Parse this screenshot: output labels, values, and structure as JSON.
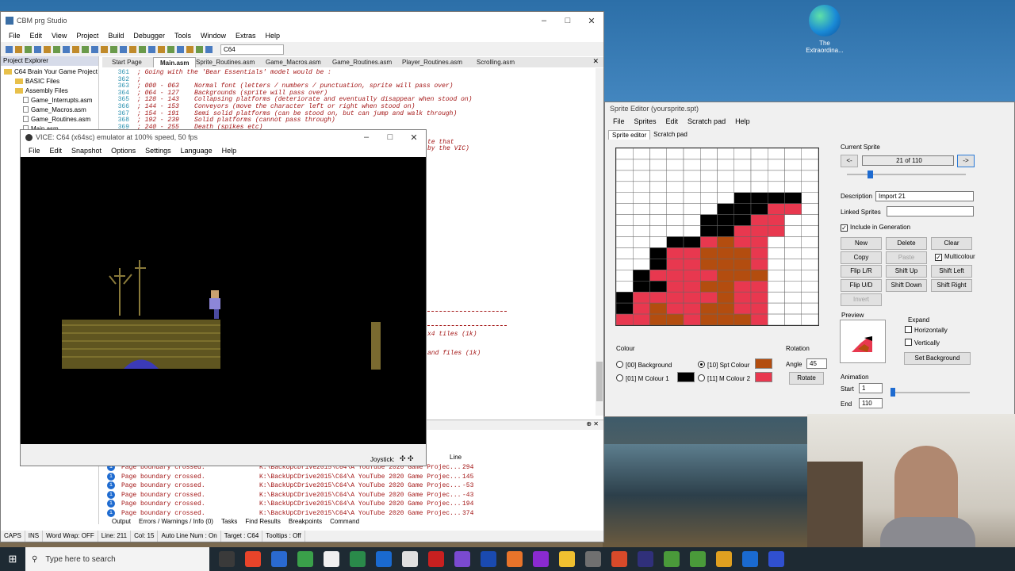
{
  "desktop": {
    "edge_label": "The Extraordina..."
  },
  "ide": {
    "title": "CBM prg Studio",
    "menu": [
      "File",
      "Edit",
      "View",
      "Project",
      "Build",
      "Debugger",
      "Tools",
      "Window",
      "Extras",
      "Help"
    ],
    "toolbar_target": "C64",
    "project_explorer": {
      "title": "Project Explorer",
      "root": "C64 Brain Your Game Project",
      "items": [
        "BASIC Files",
        "Assembly Files",
        "Game_Interrupts.asm",
        "Game_Macros.asm",
        "Game_Routines.asm",
        "Main.asm"
      ]
    },
    "tabs": [
      "Start Page",
      "Main.asm",
      "Sprite_Routines.asm",
      "Game_Macros.asm",
      "Game_Routines.asm",
      "Player_Routines.asm",
      "Scrolling.asm"
    ],
    "line_numbers": [
      "361",
      "362",
      "363",
      "364",
      "365",
      "366",
      "367",
      "368",
      "369"
    ],
    "code_lines": [
      "; Going with the 'Bear Essentials' model would be :",
      ";",
      "; 000 - 063    Normal font (letters / numbers / punctuation, sprite will pass over)",
      "; 064 - 127    Backgrounds (sprite will pass over)",
      "; 128 - 143    Collapsing platforms (deteriorate and eventually disappear when stood on)",
      "; 144 - 153    Conveyors (move the character left or right when stood on)",
      "; 154 - 191    Semi solid platforms (can be stood on, but can jump and walk through)",
      "; 192 - 239    Solid platforms (cannot pass through)",
      "; 240 - 255    Death (spikes etc)"
    ],
    "code_fragments": [
      "te that",
      "by the VIC)",
      "x4 tiles (1k)",
      "and files (1k)"
    ],
    "output": {
      "line_header": "Line",
      "rows": [
        {
          "msg": "Page boundary crossed.",
          "file": "K:\\BackUpCDrive2015\\C64\\A YouTube 2020 Game Projec...",
          "line": "294"
        },
        {
          "msg": "Page boundary crossed.",
          "file": "K:\\BackUpCDrive2015\\C64\\A YouTube 2020 Game Projec...",
          "line": "145"
        },
        {
          "msg": "Page boundary crossed.",
          "file": "K:\\BackUpCDrive2015\\C64\\A YouTube 2020 Game Projec...",
          "line": "-53"
        },
        {
          "msg": "Page boundary crossed.",
          "file": "K:\\BackUpCDrive2015\\C64\\A YouTube 2020 Game Projec...",
          "line": "-43"
        },
        {
          "msg": "Page boundary crossed.",
          "file": "K:\\BackUpCDrive2015\\C64\\A YouTube 2020 Game Projec...",
          "line": "194"
        },
        {
          "msg": "Page boundary crossed.",
          "file": "K:\\BackUpCDrive2015\\C64\\A YouTube 2020 Game Projec...",
          "line": "374"
        }
      ]
    },
    "bottom_tabs": [
      "Output",
      "Errors / Warnings / Info (0)",
      "Tasks",
      "Find Results",
      "Breakpoints",
      "Command"
    ],
    "status": [
      "CAPS",
      "INS",
      "Word Wrap: OFF",
      "Line: 211",
      "Col: 15",
      "Auto Line Num : On",
      "Target : C64",
      "Tooltips : Off"
    ]
  },
  "vice": {
    "title": "VICE: C64 (x64sc) emulator at 100% speed, 50 fps",
    "menu": [
      "File",
      "Edit",
      "Snapshot",
      "Options",
      "Settings",
      "Language",
      "Help"
    ],
    "joystick": "Joystick:"
  },
  "sprite_editor": {
    "title": "Sprite Editor (yoursprite.spt)",
    "menu": [
      "File",
      "Sprites",
      "Edit",
      "Scratch pad",
      "Help"
    ],
    "tabs": [
      "Sprite editor",
      "Scratch pad"
    ],
    "current_sprite_label": "Current Sprite",
    "prev": "<-",
    "next": "->",
    "counter": "21 of 110",
    "description_label": "Description",
    "description": "Import 21",
    "linked_label": "Linked Sprites",
    "include_label": "Include in Generation",
    "buttons": [
      "New",
      "Delete",
      "Clear",
      "Copy",
      "Paste",
      "Flip L/R",
      "Shift Up",
      "Shift Left",
      "Flip U/D",
      "Shift Down",
      "Shift Right",
      "Invert"
    ],
    "multicolour": "Multicolour",
    "preview_label": "Preview",
    "expand_label": "Expand",
    "horizontally": "Horizontally",
    "vertically": "Vertically",
    "set_background": "Set Background",
    "colour_label": "Colour",
    "colours": [
      {
        "label": "[00] Background",
        "color": "#ffffff"
      },
      {
        "label": "[01] M Colour 1",
        "color": "#000000"
      },
      {
        "label": "[10] Spt Colour",
        "color": "#b34d0f"
      },
      {
        "label": "[11] M Colour 2",
        "color": "#e8384f"
      }
    ],
    "rotation_label": "Rotation",
    "angle_label": "Angle",
    "angle": "45",
    "rotate": "Rotate",
    "animation_label": "Animation",
    "start_label": "Start",
    "start": "1",
    "end_label": "End",
    "end": "110",
    "grid_rows": [
      "000000000000",
      "000000000000",
      "000000000000",
      "000000000000",
      "000000011110",
      "000000111220",
      "000001112200",
      "000001122200",
      "000112322000",
      "001223332000",
      "001223332000",
      "012222333000",
      "011223322000",
      "122222322000",
      "123223322000",
      "223323332000"
    ]
  },
  "taskbar": {
    "search_placeholder": "Type here to search"
  }
}
